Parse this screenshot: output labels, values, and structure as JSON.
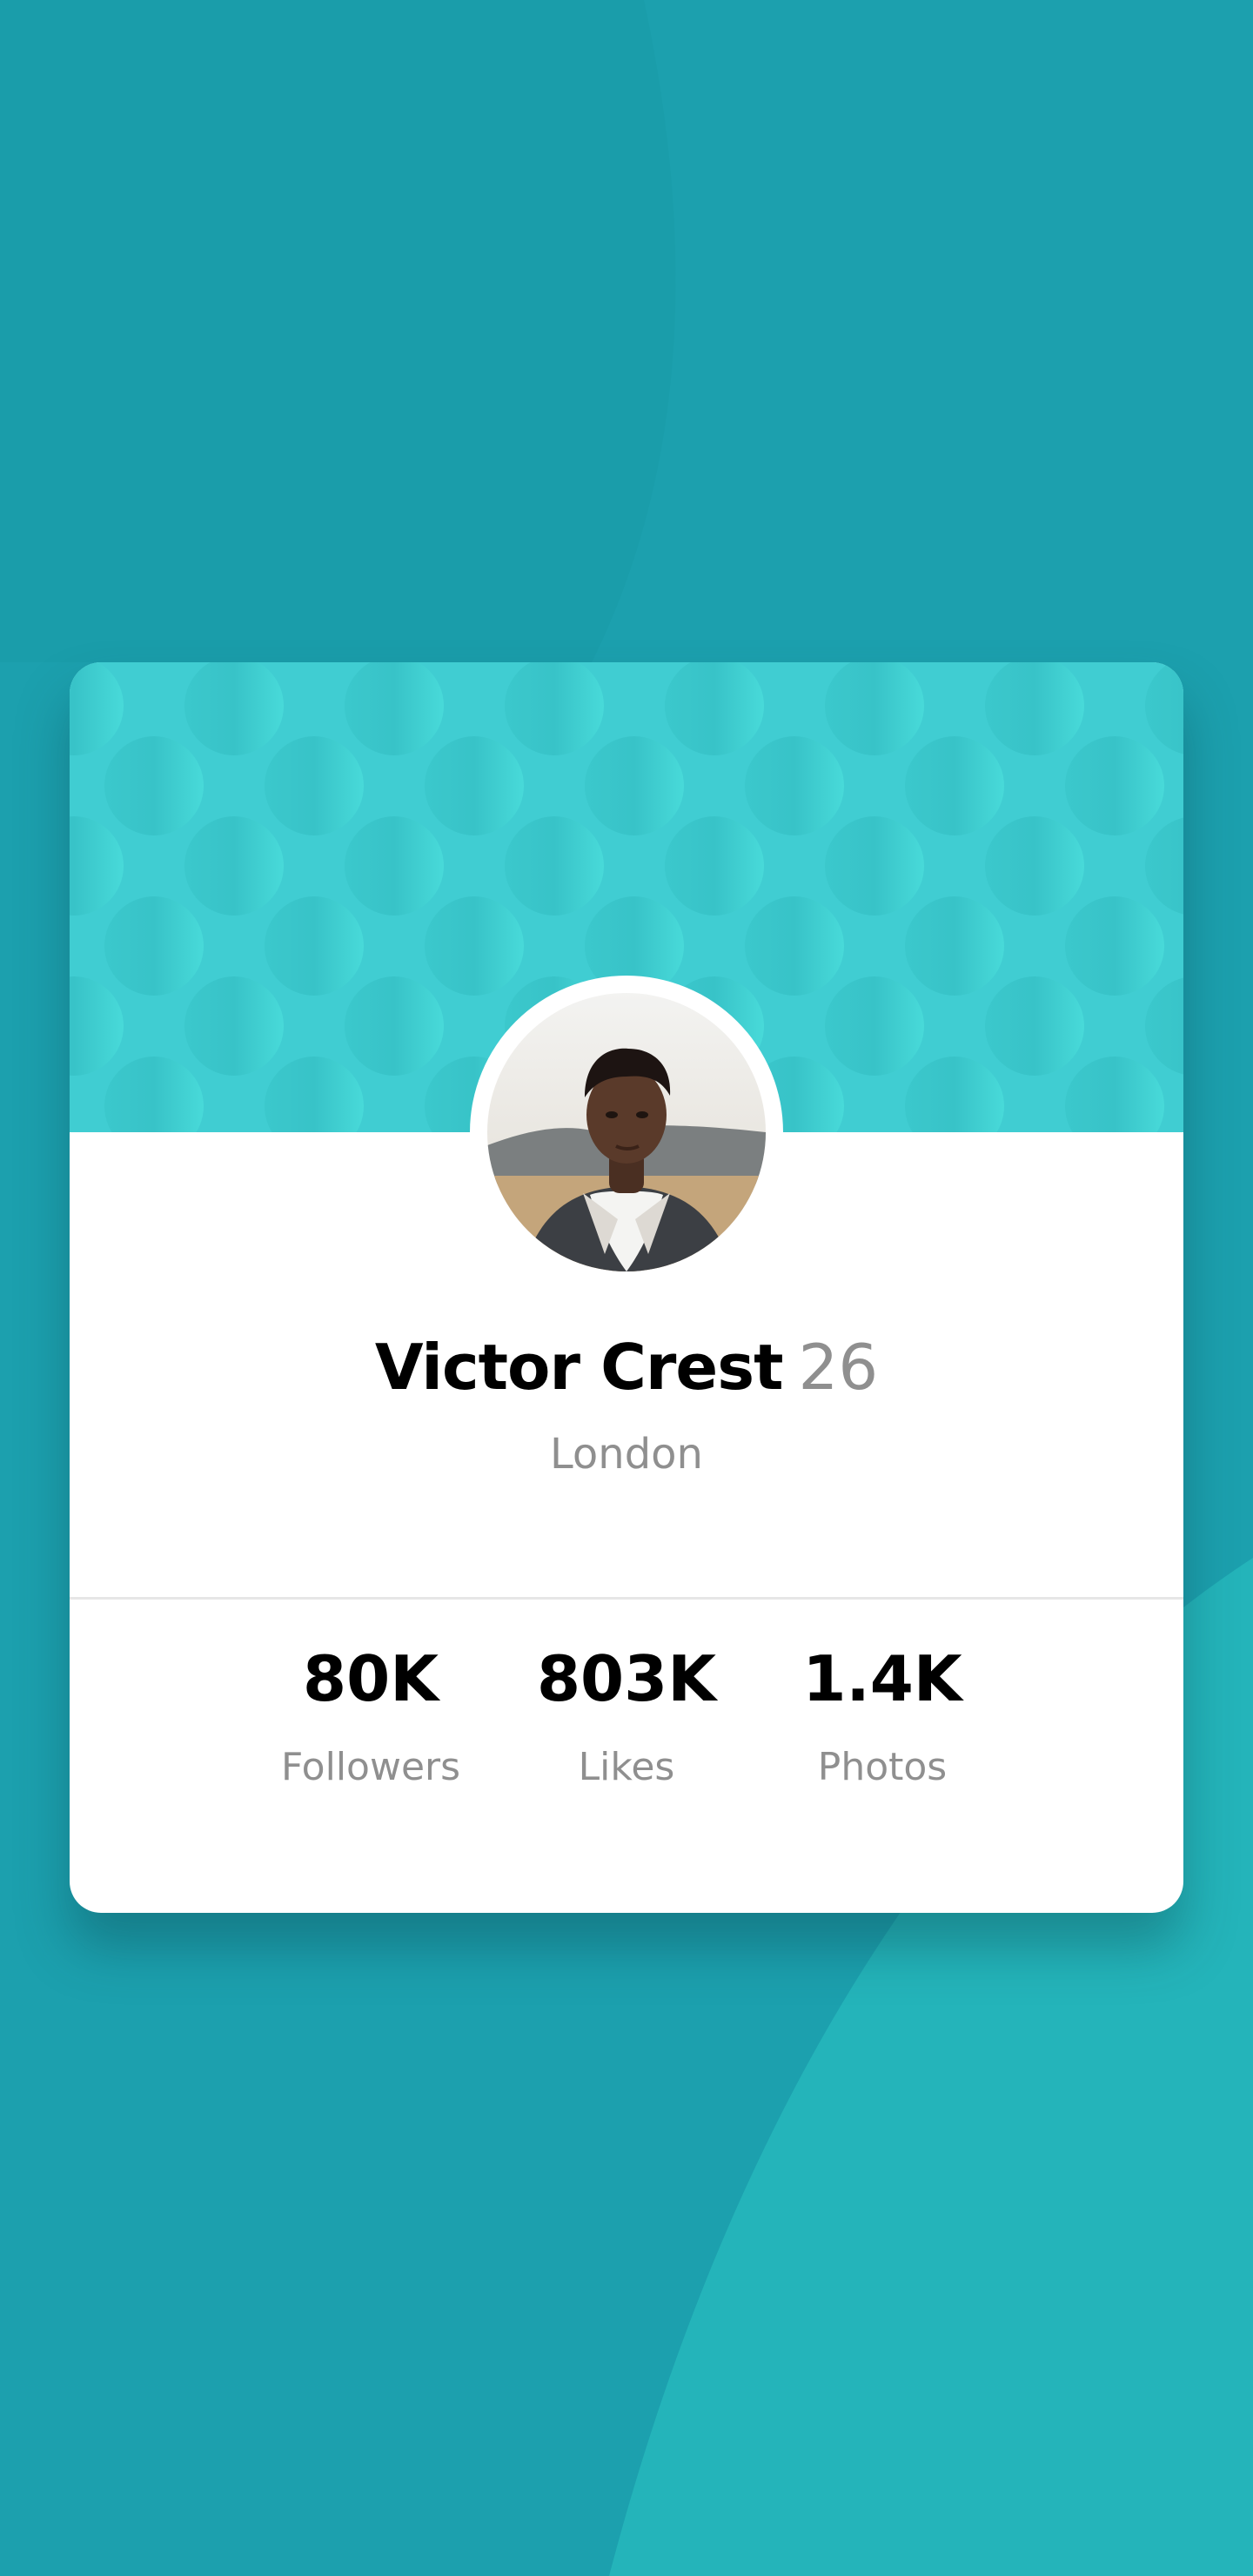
{
  "colors": {
    "background": "#1ca0ae",
    "background_shape": "#24b4ba",
    "header_pattern": "#40cdd2",
    "card": "#ffffff",
    "primary_text": "#000000",
    "secondary_text": "#8f8f8f"
  },
  "profile": {
    "name": "Victor Crest",
    "age": "26",
    "location": "London",
    "avatar_icon": "profile-photo"
  },
  "stats": [
    {
      "value": "80K",
      "label": "Followers"
    },
    {
      "value": "803K",
      "label": "Likes"
    },
    {
      "value": "1.4K",
      "label": "Photos"
    }
  ]
}
